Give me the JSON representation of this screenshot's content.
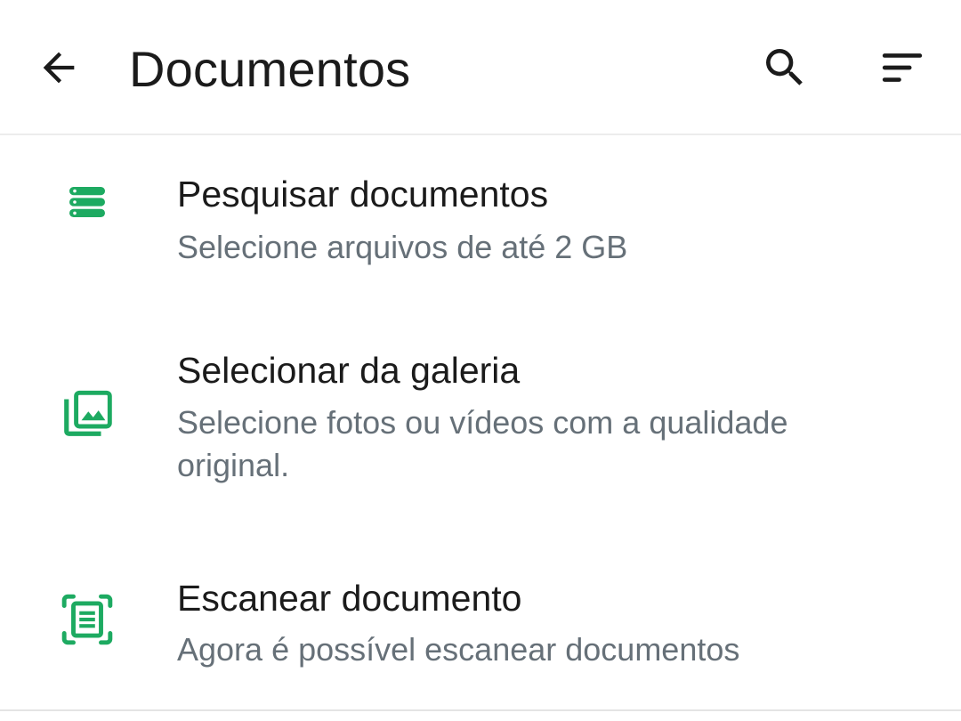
{
  "header": {
    "title": "Documentos",
    "back_icon": "arrow-back-icon",
    "search_icon": "search-icon",
    "sort_icon": "sort-icon"
  },
  "colors": {
    "accent": "#1DAA61",
    "title_text": "#1B1B1B",
    "subtitle_text": "#667078"
  },
  "options": [
    {
      "title": "Pesquisar documentos",
      "subtitle": "Selecione arquivos de até 2 GB",
      "icon": "storage-icon"
    },
    {
      "title": "Selecionar da galeria",
      "subtitle": "Selecione fotos ou vídeos com a qualidade original.",
      "icon": "photo-library-icon"
    },
    {
      "title": "Escanear documento",
      "subtitle": "Agora é possível escanear documentos",
      "icon": "document-scanner-icon"
    }
  ]
}
